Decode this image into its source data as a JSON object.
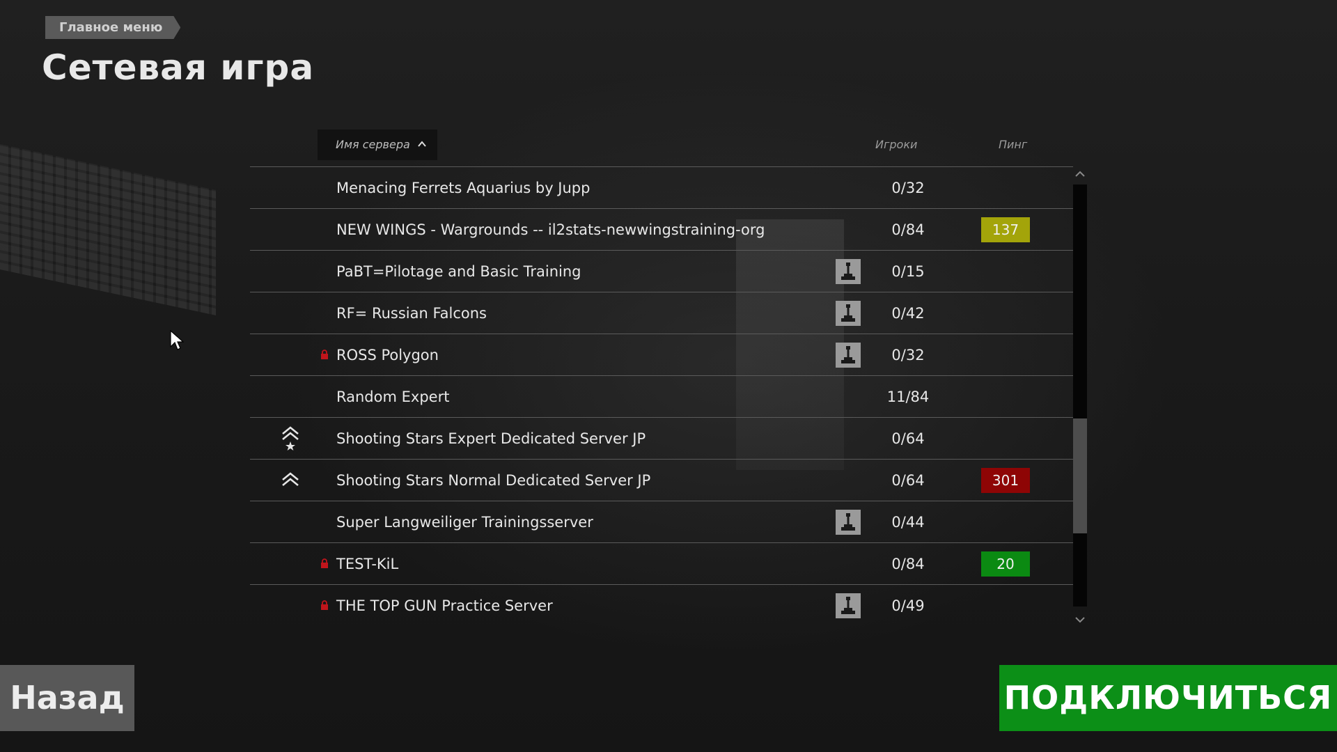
{
  "breadcrumb": "Главное меню",
  "page_title": "Сетевая игра",
  "table": {
    "columns": {
      "name": "Имя сервера",
      "players": "Игроки",
      "ping": "Пинг"
    },
    "rows": [
      {
        "name": "Menacing Ferrets Aquarius by Jupp",
        "players": "0/32",
        "ping": "",
        "ping_color": "",
        "locked": false,
        "joystick": false,
        "rank": ""
      },
      {
        "name": "NEW WINGS - Wargrounds -- il2stats-newwingstraining-org",
        "players": "0/84",
        "ping": "137",
        "ping_color": "#a3a40a",
        "locked": false,
        "joystick": false,
        "rank": ""
      },
      {
        "name": "PaBT=Pilotage and Basic Training",
        "players": "0/15",
        "ping": "",
        "ping_color": "",
        "locked": false,
        "joystick": true,
        "rank": ""
      },
      {
        "name": "RF= Russian Falcons",
        "players": "0/42",
        "ping": "",
        "ping_color": "",
        "locked": false,
        "joystick": true,
        "rank": ""
      },
      {
        "name": "ROSS Polygon",
        "players": "0/32",
        "ping": "",
        "ping_color": "",
        "locked": true,
        "joystick": true,
        "rank": ""
      },
      {
        "name": "Random Expert",
        "players": "11/84",
        "ping": "",
        "ping_color": "",
        "locked": false,
        "joystick": false,
        "rank": ""
      },
      {
        "name": "Shooting Stars Expert Dedicated Server JP",
        "players": "0/64",
        "ping": "",
        "ping_color": "",
        "locked": false,
        "joystick": false,
        "rank": "expert"
      },
      {
        "name": "Shooting Stars Normal Dedicated Server JP",
        "players": "0/64",
        "ping": "301",
        "ping_color": "#8e0505",
        "locked": false,
        "joystick": false,
        "rank": "normal"
      },
      {
        "name": "Super Langweiliger Trainingsserver",
        "players": "0/44",
        "ping": "",
        "ping_color": "",
        "locked": false,
        "joystick": true,
        "rank": ""
      },
      {
        "name": "TEST-KiL",
        "players": "0/84",
        "ping": "20",
        "ping_color": "#0b8a12",
        "locked": true,
        "joystick": false,
        "rank": ""
      },
      {
        "name": "THE TOP GUN Practice Server",
        "players": "0/49",
        "ping": "",
        "ping_color": "",
        "locked": true,
        "joystick": true,
        "rank": ""
      }
    ]
  },
  "buttons": {
    "back": "Назад",
    "connect": "ПОДКЛЮЧИТЬСЯ"
  },
  "colors": {
    "connect_green": "#0c8f17",
    "back_grey": "#585858",
    "lock_red": "#c0151b"
  }
}
